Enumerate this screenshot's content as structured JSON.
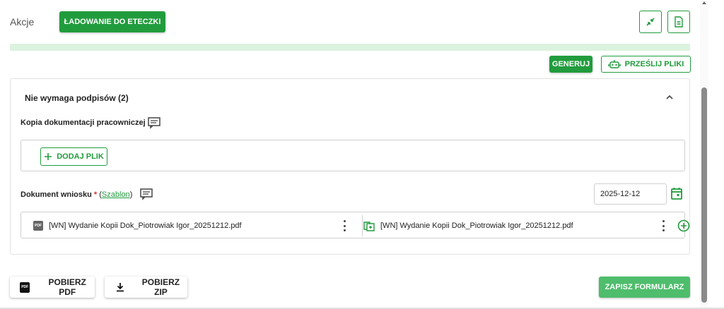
{
  "topbar": {
    "actions_label": "Akcje",
    "load_button_label": "ŁADOWANIE DO ETECZKI",
    "collapse_icon": "collapse-arrows-icon",
    "document_icon": "document-icon"
  },
  "toolbar": {
    "generate_label": "GENERUJ",
    "send_files_label": "PRZEŚLIJ PLIKI",
    "send_files_icon": "robot-icon"
  },
  "panel": {
    "title": "Nie wymaga podpisów (2)",
    "kopia": {
      "label": "Kopia dokumentacji pracowniczej",
      "add_file_label": "DODAJ PLIK"
    },
    "wniosek": {
      "label": "Dokument wniosku",
      "required_mark": "*",
      "template_open": "(",
      "template_link": "Szablon",
      "template_close": ")",
      "date_value": "2025-12-12",
      "file_left_name": "[WN] Wydanie Kopii Dok_Piotrowiak Igor_20251212.pdf",
      "file_left_badge": "PDF",
      "file_right_name": "[WN] Wydanie Kopii Dok_Piotrowiak Igor_20251212.pdf"
    }
  },
  "footer": {
    "download_pdf_label": "POBIERZ PDF",
    "download_pdf_badge": "PDF",
    "download_zip_label": "POBIERZ ZIP",
    "save_form_label": "ZAPISZ FORMULARZ"
  },
  "colors": {
    "primary_green": "#219c3d",
    "light_green_strip": "#dcf3df",
    "save_green": "#4ebd6c",
    "required_red": "#d32f2f"
  }
}
